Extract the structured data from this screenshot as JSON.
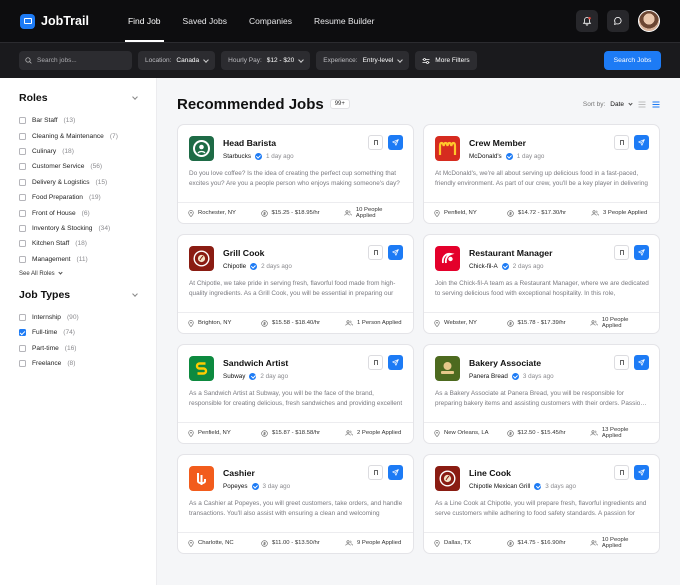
{
  "app": {
    "name": "JobTrail",
    "brand_color": "#1d7bf5"
  },
  "nav": [
    {
      "label": "Find Job",
      "active": true
    },
    {
      "label": "Saved Jobs",
      "active": false
    },
    {
      "label": "Companies",
      "active": false
    },
    {
      "label": "Resume Builder",
      "active": false
    }
  ],
  "header_icons": [
    "notification-icon",
    "message-icon",
    "avatar"
  ],
  "search": {
    "placeholder": "Search jobs...",
    "location_label": "Location:",
    "location_value": "Canada",
    "pay_label": "Hourly Pay:",
    "pay_value": "$12 - $20",
    "experience_label": "Experience:",
    "experience_value": "Entry-level",
    "more_filters": "More Filters",
    "button": "Search Jobs"
  },
  "sidebar": {
    "roles_title": "Roles",
    "roles": [
      {
        "label": "Bar Staff",
        "count": "(13)",
        "checked": false
      },
      {
        "label": "Cleaning & Maintenance",
        "count": "(7)",
        "checked": false
      },
      {
        "label": "Culinary",
        "count": "(18)",
        "checked": false
      },
      {
        "label": "Customer Service",
        "count": "(56)",
        "checked": false
      },
      {
        "label": "Delivery & Logistics",
        "count": "(15)",
        "checked": false
      },
      {
        "label": "Food Preparation",
        "count": "(19)",
        "checked": false
      },
      {
        "label": "Front of House",
        "count": "(6)",
        "checked": false
      },
      {
        "label": "Inventory & Stocking",
        "count": "(34)",
        "checked": false
      },
      {
        "label": "Kitchen Staff",
        "count": "(18)",
        "checked": false
      },
      {
        "label": "Management",
        "count": "(11)",
        "checked": false
      }
    ],
    "see_all": "See All Roles",
    "types_title": "Job Types",
    "types": [
      {
        "label": "Internship",
        "count": "(90)",
        "checked": false
      },
      {
        "label": "Full-time",
        "count": "(74)",
        "checked": true
      },
      {
        "label": "Part-time",
        "count": "(16)",
        "checked": false
      },
      {
        "label": "Freelance",
        "count": "(8)",
        "checked": false
      }
    ]
  },
  "main": {
    "title": "Recommended Jobs",
    "count": "99+",
    "sort_label": "Sort by:",
    "sort_value": "Date"
  },
  "jobs": [
    {
      "title": "Head Barista",
      "company": "Starbucks",
      "ago": "1 day ago",
      "logo": "starbucks",
      "desc": "Do you love coffee? Is the idea of creating the perfect cup something that excites you? Are you a people person who enjoys making someone's day?",
      "location": "Rochester, NY",
      "pay": "$15.25 - $18.95/hr",
      "applied": "10 People Applied"
    },
    {
      "title": "Crew Member",
      "company": "McDonald's",
      "ago": "1 day ago",
      "logo": "mcdonalds",
      "desc": "At McDonald's, we're all about serving up delicious food in a fast-paced, friendly environment. As part of our crew, you'll be a key player in delivering",
      "location": "Penfield, NY",
      "pay": "$14.72 - $17.30/hr",
      "applied": "3 People Applied"
    },
    {
      "title": "Grill Cook",
      "company": "Chipotle",
      "ago": "2 days ago",
      "logo": "chipotle",
      "desc": "At Chipotle, we take pride in serving fresh, flavorful food made from high-quality ingredients. As a Grill Cook, you will be essential in preparing our",
      "location": "Brighton, NY",
      "pay": "$15.58 - $18.40/hr",
      "applied": "1 Person Applied"
    },
    {
      "title": "Restaurant Manager",
      "company": "Chick-fil-A",
      "ago": "2 days ago",
      "logo": "chickfila",
      "desc": "Join the Chick-fil-A team as a Restaurant Manager, where we are dedicated to serving delicious food with exceptional hospitality. In this role,",
      "location": "Webster, NY",
      "pay": "$15.78 - $17.39/hr",
      "applied": "10 People Applied"
    },
    {
      "title": "Sandwich Artist",
      "company": "Subway",
      "ago": "2 day ago",
      "logo": "subway",
      "desc": "As a Sandwich Artist at Subway, you will be the face of the brand, responsible for creating delicious, fresh sandwiches and providing excellent",
      "location": "Penfield, NY",
      "pay": "$15.87 - $18.58/hr",
      "applied": "2 People Applied"
    },
    {
      "title": "Bakery Associate",
      "company": "Panera Bread",
      "ago": "3 days ago",
      "logo": "panera",
      "desc": "As a Bakery Associate at Panera Bread, you will be responsible for preparing bakery items and assisting customers with their orders. Passion for",
      "location": "New Orleans, LA",
      "pay": "$12.50 - $15.45/hr",
      "applied": "13 People Applied"
    },
    {
      "title": "Cashier",
      "company": "Popeyes",
      "ago": "3 day ago",
      "logo": "popeyes",
      "desc": "As a Cashier at Popeyes, you will greet customers, take orders, and handle transactions. You'll also assist with ensuring a clean and welcoming",
      "location": "Charlotte, NC",
      "pay": "$11.00 - $13.50/hr",
      "applied": "9 People Applied"
    },
    {
      "title": "Line Cook",
      "company": "Chipotle Mexican Grill",
      "ago": "3 days ago",
      "logo": "chipotle",
      "desc": "As a Line Cook at Chipotle, you will prepare fresh, flavorful ingredients and serve customers while adhering to food safety standards. A passion for",
      "location": "Dallas, TX",
      "pay": "$14.75 - $16.90/hr",
      "applied": "10 People Applied"
    }
  ]
}
